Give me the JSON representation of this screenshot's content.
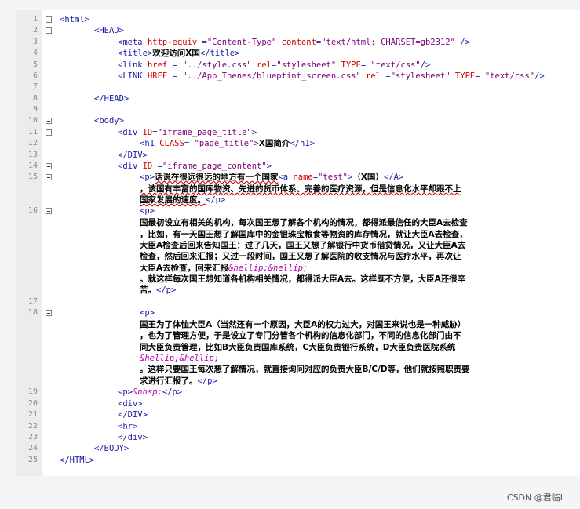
{
  "lines": [
    {
      "n": "1",
      "parts": [
        [
          "tg",
          "<html>"
        ]
      ]
    },
    {
      "n": "2",
      "parts": [
        [
          "tg",
          "<HEAD>"
        ]
      ]
    },
    {
      "n": "3",
      "parts": [
        [
          "tg",
          "<meta "
        ],
        [
          "an",
          "http-equiv "
        ],
        [
          "tg",
          "="
        ],
        [
          "av",
          "\"Content-Type\" "
        ],
        [
          "an",
          "content"
        ],
        [
          "tg",
          "="
        ],
        [
          "av",
          "\"text/html; CHARSET=gb2312\""
        ],
        [
          "tg",
          " />"
        ]
      ]
    },
    {
      "n": "4",
      "parts": [
        [
          "tg",
          "<title>"
        ],
        [
          "tx",
          "欢迎访问X国"
        ],
        [
          "tg",
          "</title>"
        ]
      ]
    },
    {
      "n": "5",
      "parts": [
        [
          "tg",
          "<link "
        ],
        [
          "an",
          "href "
        ],
        [
          "tg",
          "= "
        ],
        [
          "av",
          "\"../style.css\" "
        ],
        [
          "an",
          "rel"
        ],
        [
          "tg",
          "="
        ],
        [
          "av",
          "\"stylesheet\" "
        ],
        [
          "an",
          "TYPE"
        ],
        [
          "tg",
          "= "
        ],
        [
          "av",
          "\"text/css\""
        ],
        [
          "tg",
          "/>"
        ]
      ]
    },
    {
      "n": "6",
      "parts": [
        [
          "tg",
          "<LINK "
        ],
        [
          "an",
          "HREF "
        ],
        [
          "tg",
          "= "
        ],
        [
          "av",
          "\"../App_Thenes/blueptint_screen.css\" "
        ],
        [
          "an",
          "rel "
        ],
        [
          "tg",
          "="
        ],
        [
          "av",
          "\"stylesheet\" "
        ],
        [
          "an",
          "TYPE"
        ],
        [
          "tg",
          "= "
        ],
        [
          "av",
          "\"text/css\""
        ],
        [
          "tg",
          "/>"
        ]
      ]
    },
    {
      "n": "7",
      "parts": []
    },
    {
      "n": "8",
      "parts": [
        [
          "tg",
          "</HEAD>"
        ]
      ]
    },
    {
      "n": "9",
      "parts": []
    },
    {
      "n": "10",
      "parts": [
        [
          "tg",
          "<body>"
        ]
      ]
    },
    {
      "n": "11",
      "parts": [
        [
          "tg",
          "<div "
        ],
        [
          "an",
          "ID"
        ],
        [
          "tg",
          "="
        ],
        [
          "av",
          "\"iframe_page_title\""
        ],
        [
          "tg",
          ">"
        ]
      ]
    },
    {
      "n": "12",
      "parts": [
        [
          "tg",
          "<h1 "
        ],
        [
          "an",
          "CLASS"
        ],
        [
          "tg",
          "= "
        ],
        [
          "av",
          "\"page_title\""
        ],
        [
          "tg",
          ">"
        ],
        [
          "tx",
          "X国简介"
        ],
        [
          "tg",
          "</h1>"
        ]
      ]
    },
    {
      "n": "13",
      "parts": [
        [
          "tg",
          "</DIV>"
        ]
      ]
    },
    {
      "n": "14",
      "parts": [
        [
          "tg",
          "<div "
        ],
        [
          "an",
          "ID "
        ],
        [
          "tg",
          "="
        ],
        [
          "av",
          "\"iframe_page_content\""
        ],
        [
          "tg",
          ">"
        ]
      ]
    },
    {
      "n": "15",
      "parts": [
        [
          "tg",
          "<p>"
        ],
        [
          "txw",
          "话说在很远很远的地方有一个国家"
        ],
        [
          "tg",
          "<a "
        ],
        [
          "an",
          "name"
        ],
        [
          "tg",
          "="
        ],
        [
          "av",
          "\"test\""
        ],
        [
          "tg",
          ">"
        ],
        [
          "tx",
          "（X国）"
        ],
        [
          "tg",
          "</A>"
        ]
      ]
    },
    {
      "n": "",
      "parts": [
        [
          "txw",
          "，该国有丰富的国库物资、先进的货币体系、完善的医疗资源，但是信息化水平却跟不上"
        ]
      ]
    },
    {
      "n": "",
      "parts": [
        [
          "txw",
          "国家发展的速度。"
        ],
        [
          "tg",
          "</p>"
        ]
      ]
    },
    {
      "n": "16",
      "parts": [
        [
          "tg",
          "<p>"
        ]
      ]
    },
    {
      "n": "",
      "parts": [
        [
          "tx",
          "国最初设立有相关的机构，每次国王想了解各个机构的情况，都得派最信任的大臣A去检查"
        ]
      ]
    },
    {
      "n": "",
      "parts": [
        [
          "tx",
          "，比如，有一天国王想了解国库中的金银珠宝粮食等物资的库存情况，就让大臣A去检查，"
        ]
      ]
    },
    {
      "n": "",
      "parts": [
        [
          "tx",
          "大臣A检查后回来告知国王：过了几天，国王又想了解银行中货币借贷情况，又让大臣A去"
        ]
      ]
    },
    {
      "n": "",
      "parts": [
        [
          "tx",
          "检查，然后回来汇报；又过一段时间，国王又想了解医院的收支情况与医疗水平，再次让"
        ]
      ]
    },
    {
      "n": "",
      "parts": [
        [
          "tx",
          "大臣A去检查，回来汇报"
        ],
        [
          "ent",
          "&hellip;&hellip;"
        ]
      ]
    },
    {
      "n": "",
      "parts": [
        [
          "tx",
          "。就这样每次国王想知道各机构相关情况，都得派大臣A去。这样既不方便，大臣A还很辛"
        ]
      ]
    },
    {
      "n": "",
      "parts": [
        [
          "tx",
          "苦。"
        ],
        [
          "tg",
          "</p>"
        ]
      ]
    },
    {
      "n": "17",
      "parts": []
    },
    {
      "n": "18",
      "parts": [
        [
          "tg",
          "<p>"
        ]
      ]
    },
    {
      "n": "",
      "parts": [
        [
          "tx",
          "国王为了体恤大臣A（当然还有一个原因，大臣A的权力过大，对国王来说也是一种威胁）"
        ]
      ]
    },
    {
      "n": "",
      "parts": [
        [
          "tx",
          "，也为了管理方便，于是设立了专门分管各个机构的信息化部门，不同的信息化部门由不"
        ]
      ]
    },
    {
      "n": "",
      "parts": [
        [
          "tx",
          "同大臣负责管理，比如B大臣负责国库系统，C大臣负责银行系统，D大臣负责医院系统"
        ]
      ]
    },
    {
      "n": "",
      "parts": [
        [
          "ent",
          "&hellip;&hellip;"
        ]
      ]
    },
    {
      "n": "",
      "parts": [
        [
          "tx",
          "。这样只要国王每次想了解情况，就直接询问对应的负责大臣B/C/D等，他们就按照职责要"
        ]
      ]
    },
    {
      "n": "",
      "parts": [
        [
          "tx",
          "求进行汇报了。"
        ],
        [
          "tg",
          "</p>"
        ]
      ]
    },
    {
      "n": "19",
      "parts": [
        [
          "tg",
          "<p>"
        ],
        [
          "ent",
          "&nbsp;"
        ],
        [
          "tg",
          "</p>"
        ]
      ]
    },
    {
      "n": "20",
      "parts": [
        [
          "tg",
          "<div>"
        ]
      ]
    },
    {
      "n": "21",
      "parts": [
        [
          "tg",
          "</DIV>"
        ]
      ]
    },
    {
      "n": "22",
      "parts": [
        [
          "tg",
          "<hr>"
        ]
      ]
    },
    {
      "n": "23",
      "parts": [
        [
          "tg",
          "</div>"
        ]
      ]
    },
    {
      "n": "24",
      "parts": [
        [
          "tg",
          "</BODY>"
        ]
      ]
    },
    {
      "n": "25",
      "parts": [
        [
          "tg",
          "</HTML>"
        ]
      ]
    }
  ],
  "watermark": "CSDN @君临I"
}
